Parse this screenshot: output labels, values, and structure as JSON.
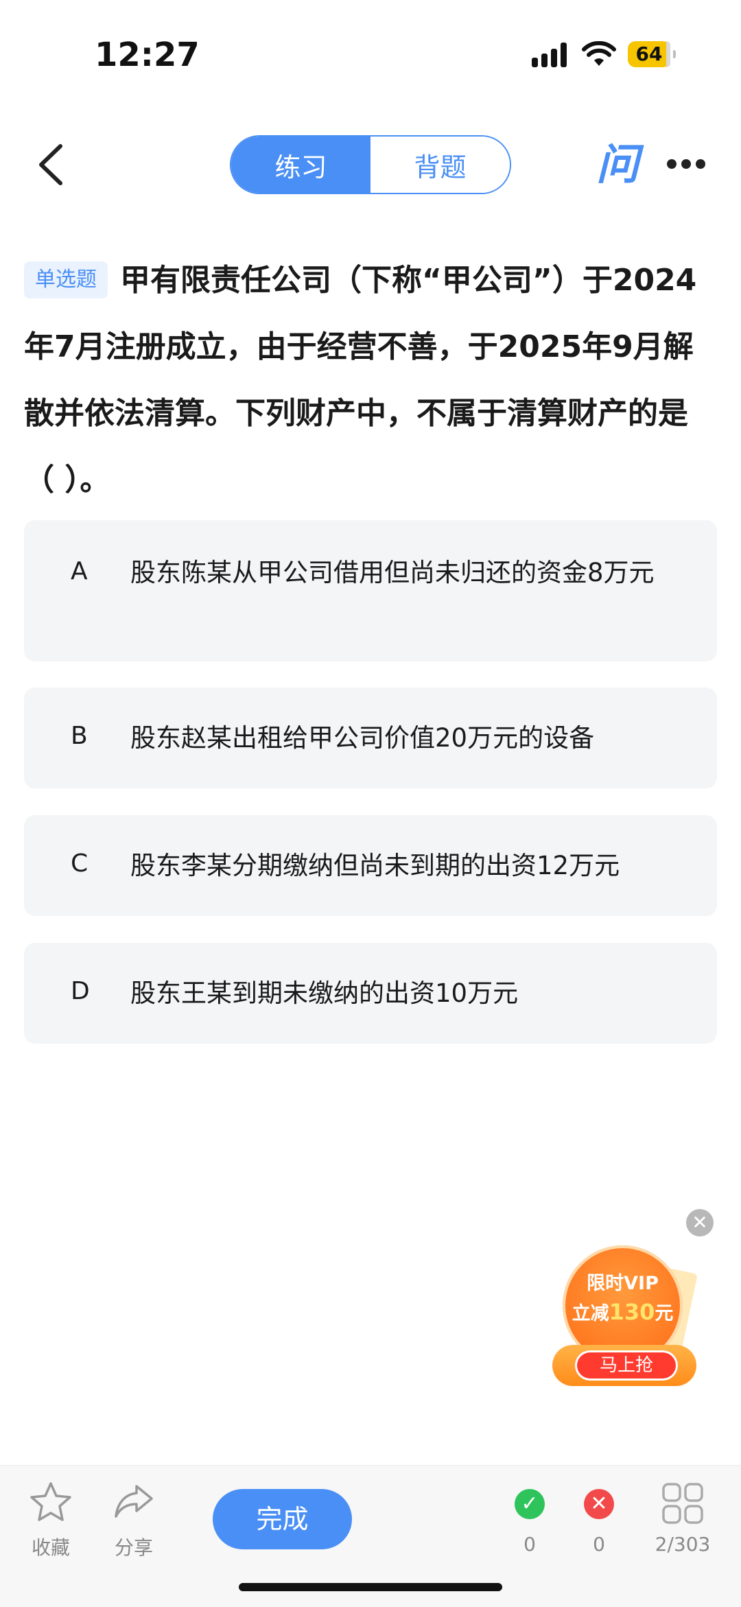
{
  "status_bar": {
    "time": "12:27",
    "battery": "64"
  },
  "header": {
    "tabs": [
      {
        "label": "练习"
      },
      {
        "label": "背题"
      }
    ],
    "ask_icon": "问"
  },
  "question": {
    "type_tag": "单选题",
    "text": "甲有限责任公司（下称“甲公司”）于2024年7月注册成立，由于经营不善，于2025年9月解散并依法清算。下列财产中，不属于清算财产的是（ ）。"
  },
  "options": [
    {
      "letter": "A",
      "text": "股东陈某从甲公司借用但尚未归还的资金8万元"
    },
    {
      "letter": "B",
      "text": "股东赵某出租给甲公司价值20万元的设备"
    },
    {
      "letter": "C",
      "text": "股东李某分期缴纳但尚未到期的出资12万元"
    },
    {
      "letter": "D",
      "text": "股东王某到期未缴纳的出资10万元"
    }
  ],
  "promo": {
    "line1": "限时VIP",
    "line2_prefix": "立减",
    "line2_amount": "130",
    "line2_suffix": "元",
    "button": "马上抢"
  },
  "bottom_bar": {
    "favorite_label": "收藏",
    "share_label": "分享",
    "done_label": "完成",
    "correct_count": "0",
    "wrong_count": "0",
    "progress": "2/303"
  },
  "colors": {
    "accent": "#4a8ff5",
    "correct": "#2fc35b",
    "wrong": "#f24a4a"
  }
}
